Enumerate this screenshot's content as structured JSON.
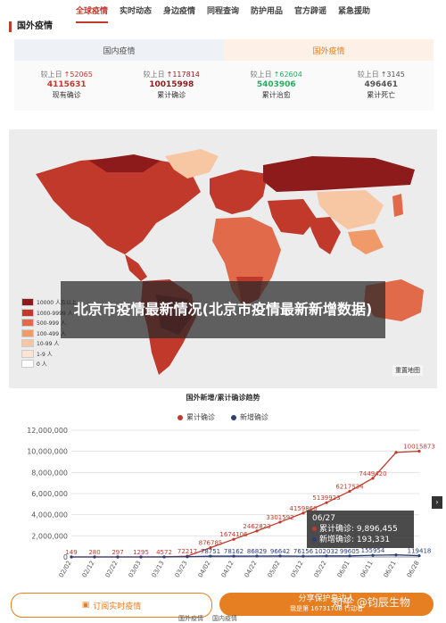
{
  "nav": {
    "items": [
      "全球疫情",
      "实时动态",
      "身边疫情",
      "同程查询",
      "防护用品",
      "官方辟谣",
      "紧急援助"
    ],
    "active": 0
  },
  "section_title": "国外疫情",
  "tabs": [
    {
      "label": "国内疫情"
    },
    {
      "label": "国外疫情"
    }
  ],
  "stats": [
    {
      "delta_label": "较上日",
      "delta": "↑52065",
      "value": "4115631",
      "label": "现有确诊",
      "color": "#c0392b"
    },
    {
      "delta_label": "较上日",
      "delta": "↑117814",
      "value": "10015998",
      "label": "累计确诊",
      "color": "#8e1b1b"
    },
    {
      "delta_label": "较上日",
      "delta": "↑62604",
      "value": "5403906",
      "label": "累计治愈",
      "color": "#27ae60"
    },
    {
      "delta_label": "较上日",
      "delta": "↑3145",
      "value": "496461",
      "label": "累计死亡",
      "color": "#555555"
    }
  ],
  "map_legend": [
    {
      "label": "10000 人及以上",
      "color": "#8e1b1b"
    },
    {
      "label": "1000-9999 人",
      "color": "#c0392b"
    },
    {
      "label": "500-999 人",
      "color": "#e06a4a"
    },
    {
      "label": "100-499 人",
      "color": "#f09a6a"
    },
    {
      "label": "10-99 人",
      "color": "#f7c6a3"
    },
    {
      "label": "1-9 人",
      "color": "#fbe4d2"
    },
    {
      "label": "0 人",
      "color": "#ffffff"
    }
  ],
  "map_button": "重置地图",
  "overlay_title": "北京市疫情最新情况(北京市疫情最新新增数据)",
  "chart_data": {
    "type": "line",
    "title": "国外新增/累计确诊趋势",
    "x": [
      "02/02",
      "02/12",
      "02/22",
      "03/03",
      "03/13",
      "03/23",
      "04/02",
      "04/12",
      "04/22",
      "05/02",
      "05/12",
      "05/22",
      "06/01",
      "06/11",
      "06/21",
      "06/28"
    ],
    "ylim": [
      0,
      12000000
    ],
    "yticks": [
      "0",
      "2,000,000",
      "4,000,000",
      "6,000,000",
      "8,000,000",
      "10,000,000",
      "12,000,000"
    ],
    "series": [
      {
        "name": "累计确诊",
        "color": "#c0392b",
        "values": [
          149,
          280,
          297,
          1295,
          4572,
          72217,
          876785,
          1674106,
          2462823,
          3301592,
          4159860,
          5139923,
          6217534,
          7449420,
          9896455,
          10015873
        ],
        "labels": [
          "149",
          "280",
          "297",
          "1295",
          "4572",
          "72217",
          "876785",
          "1674106",
          "2462823",
          "3301592",
          "4159860",
          "5139923",
          "6217534",
          "7449420",
          "",
          "10015873"
        ]
      },
      {
        "name": "新增确诊",
        "color": "#2c3e7a",
        "values": [
          2,
          20,
          63,
          1650,
          4000,
          22000,
          78751,
          78162,
          86829,
          96642,
          76156,
          102032,
          99605,
          155954,
          193331,
          119418
        ],
        "labels": [
          "",
          "",
          "",
          "",
          "",
          "",
          "78751",
          "78162",
          "86829",
          "96642",
          "76156",
          "102032",
          "99605",
          "155954",
          "",
          "119418"
        ]
      }
    ]
  },
  "tooltip": {
    "date": "06/27",
    "line1": "累计确诊: 9,896,455",
    "line2": "新增确诊: 193,331",
    "c1": "#c0392b",
    "c2": "#2c3e7a"
  },
  "buttons": {
    "subscribe": "订阅实时疫情",
    "share": "分享保护身边人"
  },
  "share_sub": "我是第 16731708 行动者",
  "watermark": "知乎 @钧辰生物",
  "bottom_tabs": [
    "国外疫情",
    "国内疫情"
  ]
}
